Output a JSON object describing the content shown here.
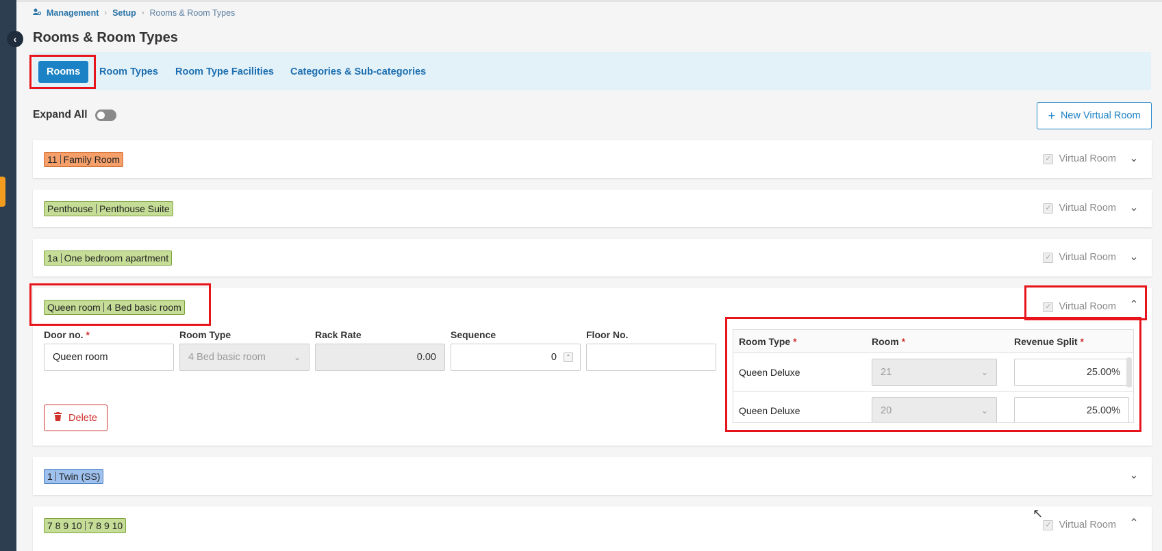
{
  "breadcrumb": {
    "root": "Management",
    "mid": "Setup",
    "current": "Rooms & Room Types"
  },
  "page_title": "Rooms & Room Types",
  "tabs": [
    {
      "label": "Rooms",
      "active": true
    },
    {
      "label": "Room Types"
    },
    {
      "label": "Room Type Facilities"
    },
    {
      "label": "Categories & Sub-categories"
    }
  ],
  "expand_all_label": "Expand All",
  "new_virtual_room_label": "New Virtual Room",
  "virtual_room_label": "Virtual Room",
  "rooms": [
    {
      "number": "11",
      "type": "Family Room",
      "color": "#f5a06b"
    },
    {
      "number": "Penthouse",
      "type": "Penthouse Suite",
      "color": "#c5dd96"
    },
    {
      "number": "1a",
      "type": "One bedroom apartment",
      "color": "#c5dd96"
    },
    {
      "number": "Queen room",
      "type": "4 Bed basic room",
      "color": "#c5dd96"
    },
    {
      "number": "1",
      "type": "Twin (SS)",
      "color": "#9ec1ee"
    },
    {
      "number": "7 8 9 10",
      "type": "7 8 9 10",
      "color": "#c5dd96"
    }
  ],
  "form": {
    "door_no_label": "Door no.",
    "door_no_value": "Queen room",
    "room_type_label": "Room Type",
    "room_type_value": "4 Bed basic room",
    "rack_rate_label": "Rack Rate",
    "rack_rate_value": "0.00",
    "sequence_label": "Sequence",
    "sequence_value": "0",
    "floor_label": "Floor No.",
    "floor_value": "",
    "delete_label": "Delete"
  },
  "virtual_table": {
    "headers": [
      "Room Type",
      "Room",
      "Revenue Split"
    ],
    "rows": [
      {
        "room_type": "Queen Deluxe",
        "room": "21",
        "split": "25.00%"
      },
      {
        "room_type": "Queen Deluxe",
        "room": "20",
        "split": "25.00%"
      }
    ]
  },
  "colors": {
    "accent": "#1b82c5",
    "sidebar": "#2c3e50",
    "highlight": "#e8141b",
    "danger": "#d0312d"
  }
}
